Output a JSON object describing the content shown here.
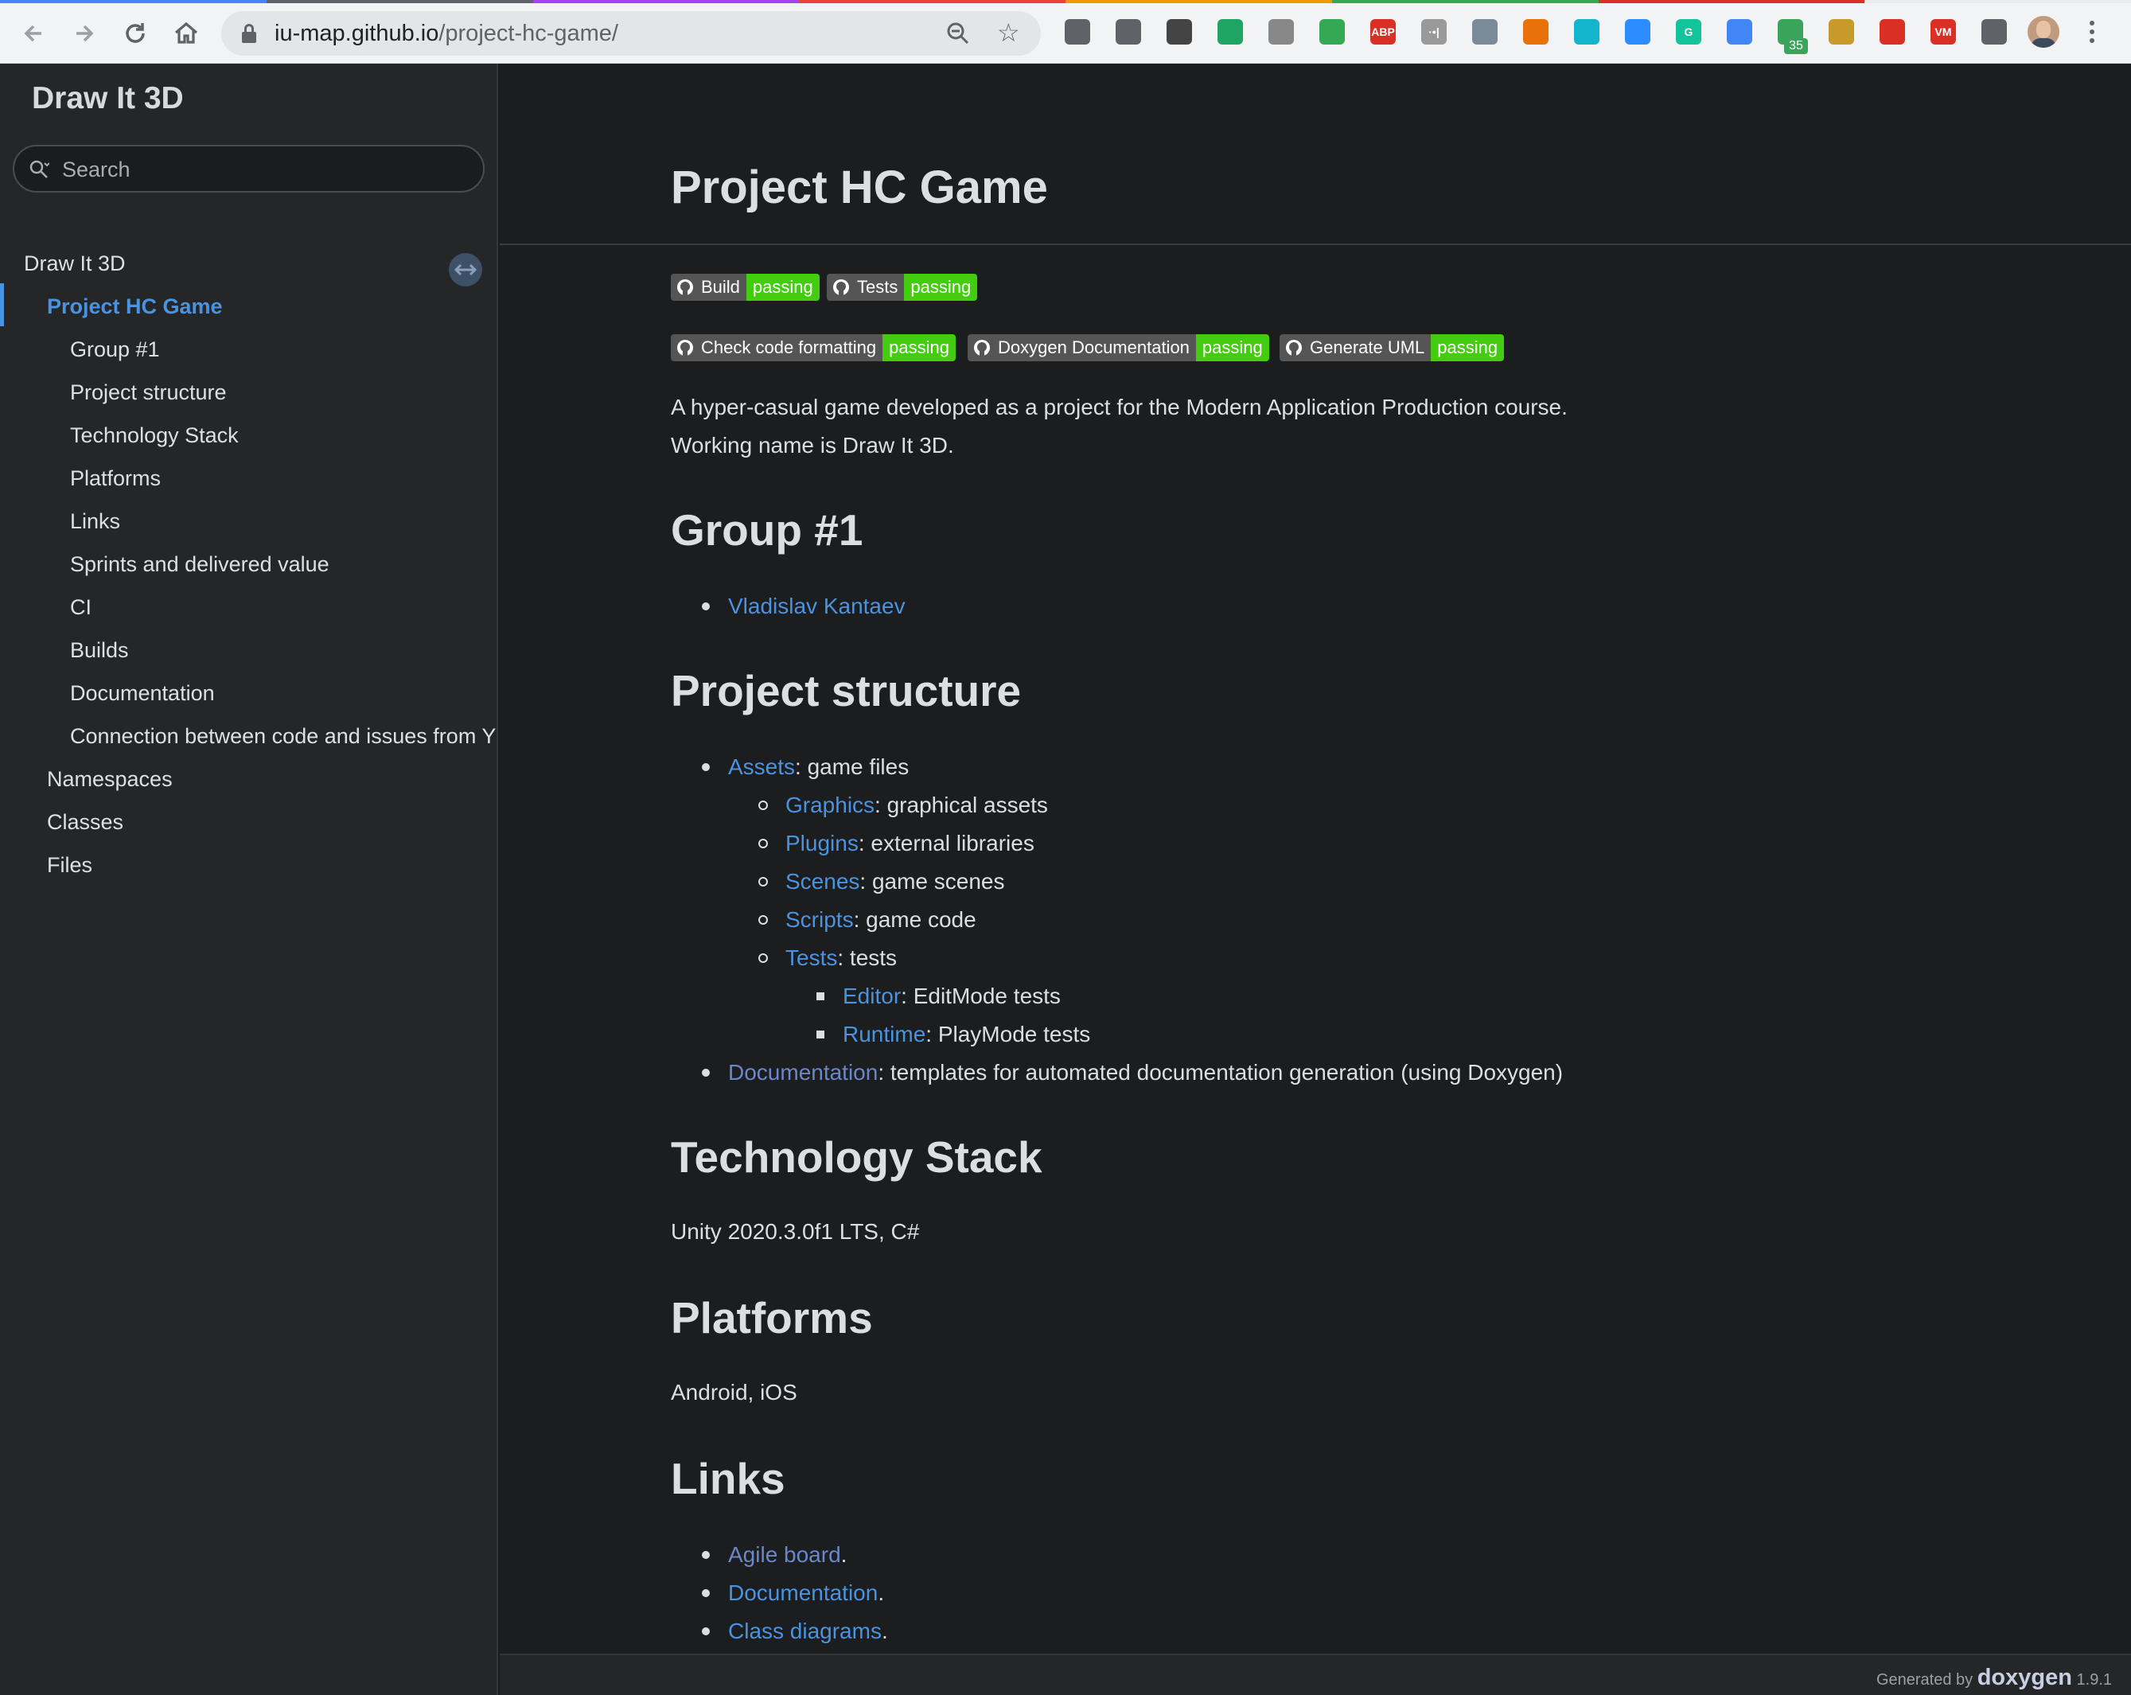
{
  "browser": {
    "url_host": "iu-map.github.io",
    "url_path": "/project-hc-game/",
    "tab_colors": [
      "#4285f4",
      "#5f6368",
      "#a142f4",
      "#ea4335",
      "#f29900",
      "#34a853",
      "#d93025",
      "#e8eaed"
    ],
    "extensions": [
      {
        "name": "bookmark-manager-icon",
        "color": "#5f6368",
        "text": ""
      },
      {
        "name": "sync-extension-icon",
        "color": "#5f6368",
        "text": ""
      },
      {
        "name": "circle-extension-icon",
        "color": "#444",
        "text": ""
      },
      {
        "name": "google-drive-icon",
        "color": "#1fa463",
        "text": ""
      },
      {
        "name": "feather-extension-icon",
        "color": "#888",
        "text": ""
      },
      {
        "name": "phone-extension-icon",
        "color": "#34a853",
        "text": ""
      },
      {
        "name": "adblock-plus-icon",
        "color": "#d93025",
        "text": "ABP"
      },
      {
        "name": "pixel-extension-icon",
        "color": "#999",
        "text": "·•|"
      },
      {
        "name": "dropbox-icon",
        "color": "#7a8a99",
        "text": ""
      },
      {
        "name": "sitemap-extension-icon",
        "color": "#e8710a",
        "text": ""
      },
      {
        "name": "sprout-extension-icon",
        "color": "#12b5cb",
        "text": ""
      },
      {
        "name": "zoom-extension-icon",
        "color": "#2d8cff",
        "text": ""
      },
      {
        "name": "grammarly-icon",
        "color": "#15c39a",
        "text": "G"
      },
      {
        "name": "pen-extension-icon",
        "color": "#4285f4",
        "text": ""
      },
      {
        "name": "evernote-icon",
        "color": "#3aa55a",
        "text": ""
      },
      {
        "name": "nest-extension-icon",
        "color": "#c79b2a",
        "text": ""
      },
      {
        "name": "acrobat-icon",
        "color": "#d93025",
        "text": ""
      },
      {
        "name": "vm-extension-icon",
        "color": "#d93025",
        "text": "VM"
      },
      {
        "name": "extensions-puzzle-icon",
        "color": "#5f6368",
        "text": ""
      }
    ],
    "extension_badge": "35"
  },
  "sidebar": {
    "project_name": "Draw It 3D",
    "search_placeholder": "Search",
    "items": [
      {
        "label": "Draw It 3D"
      },
      {
        "label": "Project HC Game"
      },
      {
        "label": "Group #1"
      },
      {
        "label": "Project structure"
      },
      {
        "label": "Technology Stack"
      },
      {
        "label": "Platforms"
      },
      {
        "label": "Links"
      },
      {
        "label": "Sprints and delivered value"
      },
      {
        "label": "CI"
      },
      {
        "label": "Builds"
      },
      {
        "label": "Documentation"
      },
      {
        "label": "Connection between code and issues from Y"
      },
      {
        "label": "Namespaces"
      },
      {
        "label": "Classes"
      },
      {
        "label": "Files"
      }
    ]
  },
  "content": {
    "title": "Project HC Game",
    "badges": [
      {
        "label": "Build",
        "status": "passing"
      },
      {
        "label": "Tests",
        "status": "passing"
      },
      {
        "label": "Check code formatting",
        "status": "passing"
      },
      {
        "label": "Doxygen Documentation",
        "status": "passing"
      },
      {
        "label": "Generate UML",
        "status": "passing"
      }
    ],
    "intro_line1": "A hyper-casual game developed as a project for the Modern Application Production course.",
    "intro_line2": "Working name is Draw It 3D.",
    "group_heading": "Group #1",
    "group_member": "Vladislav Kantaev",
    "structure_heading": "Project structure",
    "structure": {
      "assets": {
        "link": "Assets",
        "desc": ": game files"
      },
      "graphics": {
        "link": "Graphics",
        "desc": ": graphical assets"
      },
      "plugins": {
        "link": "Plugins",
        "desc": ": external libraries"
      },
      "scenes": {
        "link": "Scenes",
        "desc": ": game scenes"
      },
      "scripts": {
        "link": "Scripts",
        "desc": ": game code"
      },
      "tests": {
        "link": "Tests",
        "desc": ": tests"
      },
      "editor": {
        "link": "Editor",
        "desc": ": EditMode tests"
      },
      "runtime": {
        "link": "Runtime",
        "desc": ": PlayMode tests"
      },
      "documentation": {
        "link": "Documentation",
        "desc": ": templates for automated documentation generation (using Doxygen)"
      }
    },
    "tech_heading": "Technology Stack",
    "tech_text": "Unity 2020.3.0f1 LTS, C#",
    "platforms_heading": "Platforms",
    "platforms_text": "Android, iOS",
    "links_heading": "Links",
    "links": [
      {
        "label": "Agile board",
        "suffix": "."
      },
      {
        "label": "Documentation",
        "suffix": "."
      },
      {
        "label": "Class diagrams",
        "suffix": "."
      }
    ]
  },
  "footer": {
    "generated_by": "Generated by",
    "tool": "doxygen",
    "version": "1.9.1"
  }
}
